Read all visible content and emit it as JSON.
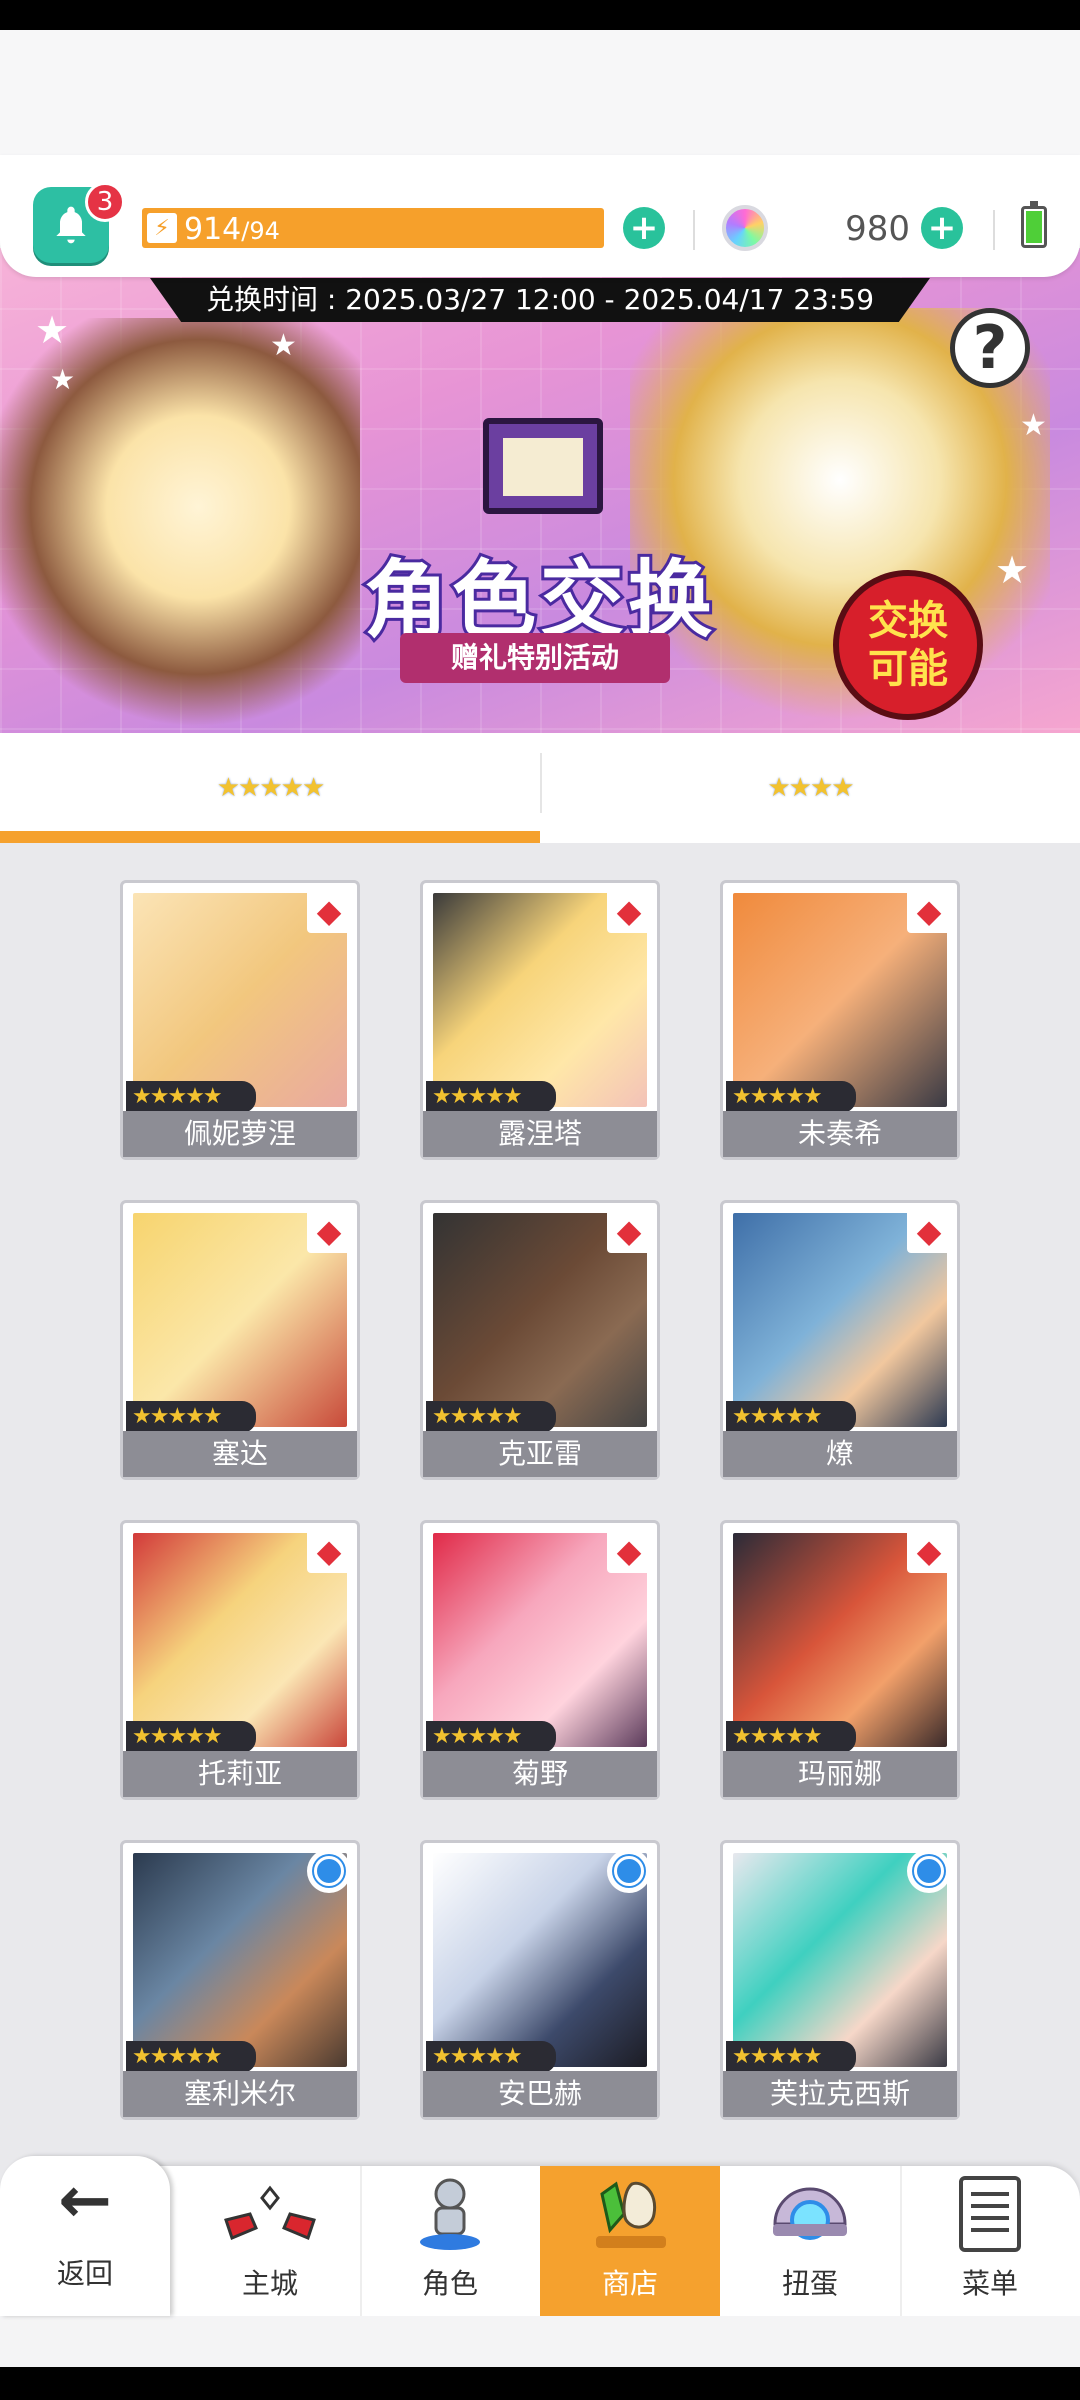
{
  "header": {
    "notification_count": "3",
    "stamina_current": "914",
    "stamina_max": "/94",
    "gem_count": "980"
  },
  "banner": {
    "exchange_time": "兑换时间 : 2025.03/27 12:00 - 2025.04/17 23:59",
    "title": "角色交换",
    "subtitle": "赠礼特别活动",
    "badge": "交换可能",
    "help": "?"
  },
  "tabs": [
    {
      "label": "★★★★★",
      "selected": true
    },
    {
      "label": "★★★★",
      "selected": false
    }
  ],
  "characters": [
    {
      "name": "佩妮萝涅",
      "stars": "★★★★★",
      "badge": "diamond"
    },
    {
      "name": "露涅塔",
      "stars": "★★★★★",
      "badge": "diamond"
    },
    {
      "name": "未奏希",
      "stars": "★★★★★",
      "badge": "diamond"
    },
    {
      "name": "塞达",
      "stars": "★★★★★",
      "badge": "diamond"
    },
    {
      "name": "克亚雷",
      "stars": "★★★★★",
      "badge": "diamond"
    },
    {
      "name": "燎",
      "stars": "★★★★★",
      "badge": "diamond"
    },
    {
      "name": "托莉亚",
      "stars": "★★★★★",
      "badge": "diamond"
    },
    {
      "name": "菊野",
      "stars": "★★★★★",
      "badge": "diamond"
    },
    {
      "name": "玛丽娜",
      "stars": "★★★★★",
      "badge": "diamond"
    },
    {
      "name": "塞利米尔",
      "stars": "★★★★★",
      "badge": "circle"
    },
    {
      "name": "安巴赫",
      "stars": "★★★★★",
      "badge": "circle"
    },
    {
      "name": "芙拉克西斯",
      "stars": "★★★★★",
      "badge": "circle"
    }
  ],
  "nav": {
    "back": "返回",
    "items": [
      "主城",
      "角色",
      "商店",
      "扭蛋",
      "菜单"
    ],
    "active": "商店"
  },
  "colors": {
    "accent": "#f5a12e",
    "teal": "#29c29b",
    "diamond_red": "#e2303b",
    "circle_blue": "#2e8de8"
  }
}
